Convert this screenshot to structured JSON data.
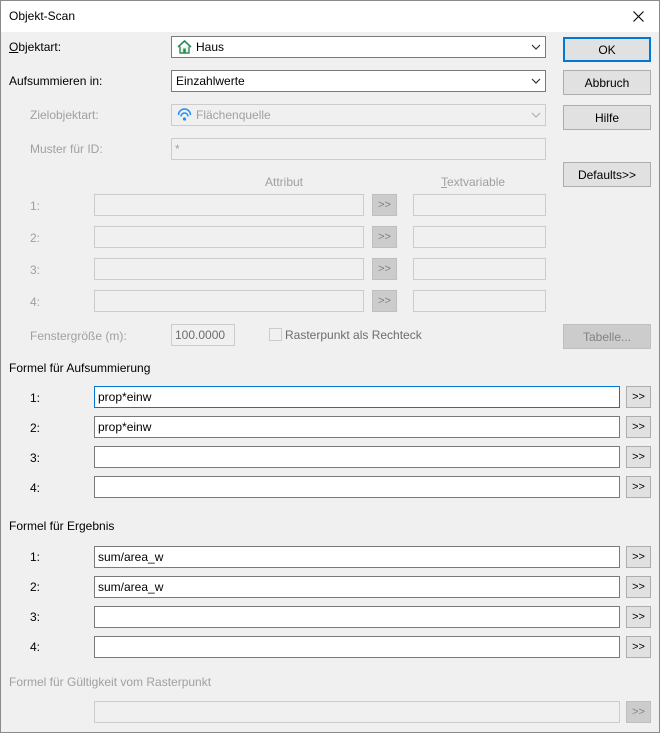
{
  "window": {
    "title": "Objekt-Scan"
  },
  "objektart": {
    "label_u": "O",
    "label_rest": "bjektart:",
    "value": "Haus"
  },
  "aufsummieren": {
    "label": "Aufsummieren in:",
    "value": "Einzahlwerte"
  },
  "zielobjektart": {
    "label": "Zielobjektart:",
    "value": "Flächenquelle"
  },
  "muster": {
    "label": "Muster für ID:",
    "value": "*"
  },
  "attr_header": "Attribut",
  "textvar_header_u": "T",
  "textvar_header_rest": "extvariable",
  "attr_rows": [
    {
      "num": "1:",
      "btn": ">>"
    },
    {
      "num": "2:",
      "btn": ">>"
    },
    {
      "num": "3:",
      "btn": ">>"
    },
    {
      "num": "4:",
      "btn": ">>"
    }
  ],
  "fenster": {
    "label": "Fenstergröße (m):",
    "value": "100.0000"
  },
  "raster_checkbox": {
    "label": "Rasterpunkt als Rechteck",
    "checked": false
  },
  "buttons": {
    "ok": "OK",
    "abbruch": "Abbruch",
    "hilfe": "Hilfe",
    "defaults": "Defaults>>",
    "tabelle": "Tabelle..."
  },
  "formel_aufsummierung": {
    "title": "Formel für Aufsummierung",
    "rows": [
      {
        "num": "1:",
        "value": "prop*einw",
        "btn": ">>"
      },
      {
        "num": "2:",
        "value": "prop*einw",
        "btn": ">>"
      },
      {
        "num": "3:",
        "value": "",
        "btn": ">>"
      },
      {
        "num": "4:",
        "value": "",
        "btn": ">>"
      }
    ]
  },
  "formel_ergebnis": {
    "title": "Formel für Ergebnis",
    "rows": [
      {
        "num": "1:",
        "value": "sum/area_w",
        "btn": ">>"
      },
      {
        "num": "2:",
        "value": "sum/area_w",
        "btn": ">>"
      },
      {
        "num": "3:",
        "value": "",
        "btn": ">>"
      },
      {
        "num": "4:",
        "value": "",
        "btn": ">>"
      }
    ]
  },
  "formel_gueltigkeit": {
    "title": "Formel für Gültigkeit vom Rasterpunkt",
    "value": "",
    "btn": ">>"
  },
  "colors": {
    "accent": "#0078d7",
    "house_icon": "#2e8b57",
    "area_icon": "#1e90ff"
  }
}
